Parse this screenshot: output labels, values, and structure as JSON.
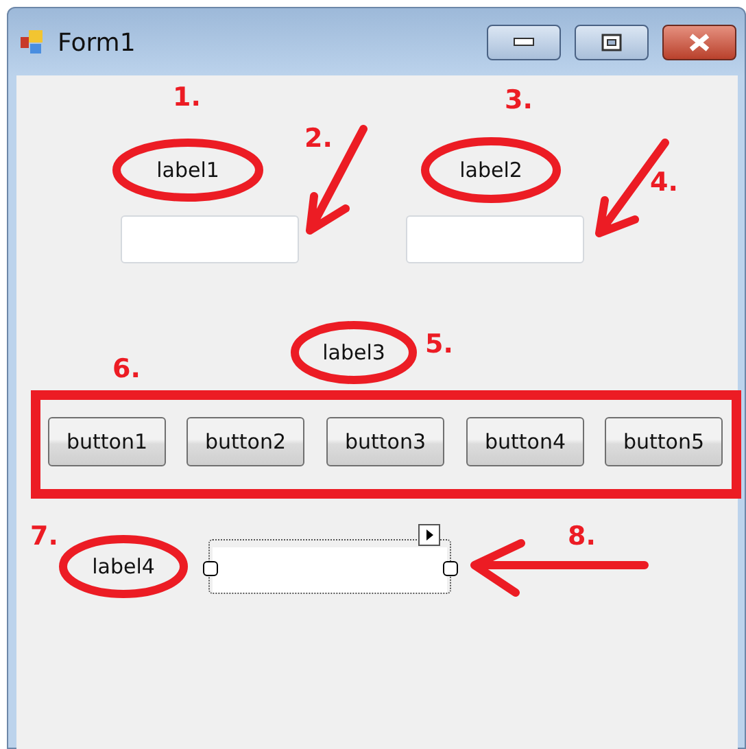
{
  "window": {
    "title": "Form1"
  },
  "labels": [
    "label1",
    "label2",
    "label3",
    "label4"
  ],
  "textboxes": [
    {
      "selected": false
    },
    {
      "selected": false
    },
    {
      "selected": true
    }
  ],
  "buttons": [
    "button1",
    "button2",
    "button3",
    "button4",
    "button5"
  ],
  "annotations": [
    "1.",
    "2.",
    "3.",
    "4.",
    "5.",
    "6.",
    "7.",
    "8."
  ]
}
